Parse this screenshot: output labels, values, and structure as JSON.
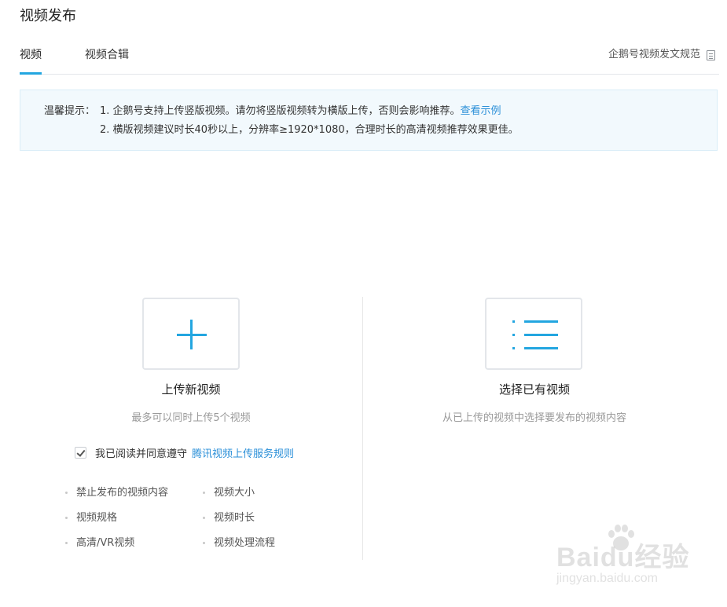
{
  "page": {
    "title": "视频发布"
  },
  "tabs": [
    {
      "label": "视频",
      "active": true
    },
    {
      "label": "视频合辑",
      "active": false
    }
  ],
  "spec_link": {
    "label": "企鹅号视频发文规范",
    "icon": "document-icon"
  },
  "notice": {
    "label": "温馨提示：",
    "line1_text": "1. 企鹅号支持上传竖版视频。请勿将竖版视频转为横版上传，否则会影响推荐。",
    "line1_link": "查看示例",
    "line2_text": "2. 横版视频建议时长40秒以上，分辨率≥1920*1080，合理时长的高清视频推荐效果更佳。"
  },
  "upload": {
    "icon": "plus-icon",
    "title": "上传新视频",
    "desc": "最多可以同时上传5个视频"
  },
  "select_existing": {
    "icon": "list-icon",
    "title": "选择已有视频",
    "desc": "从已上传的视频中选择要发布的视频内容"
  },
  "agreement": {
    "checked": true,
    "text": "我已阅读并同意遵守",
    "link": "腾讯视频上传服务规则"
  },
  "rules": {
    "left": [
      "禁止发布的视频内容",
      "视频规格",
      "高清/VR视频"
    ],
    "right": [
      "视频大小",
      "视频时长",
      "视频处理流程"
    ]
  },
  "watermark": {
    "brand": "Baidu经验",
    "url": "jingyan.baidu.com"
  },
  "colors": {
    "accent": "#23a6e0",
    "link": "#2a8fd8",
    "notice_bg": "#f2f9fd"
  }
}
